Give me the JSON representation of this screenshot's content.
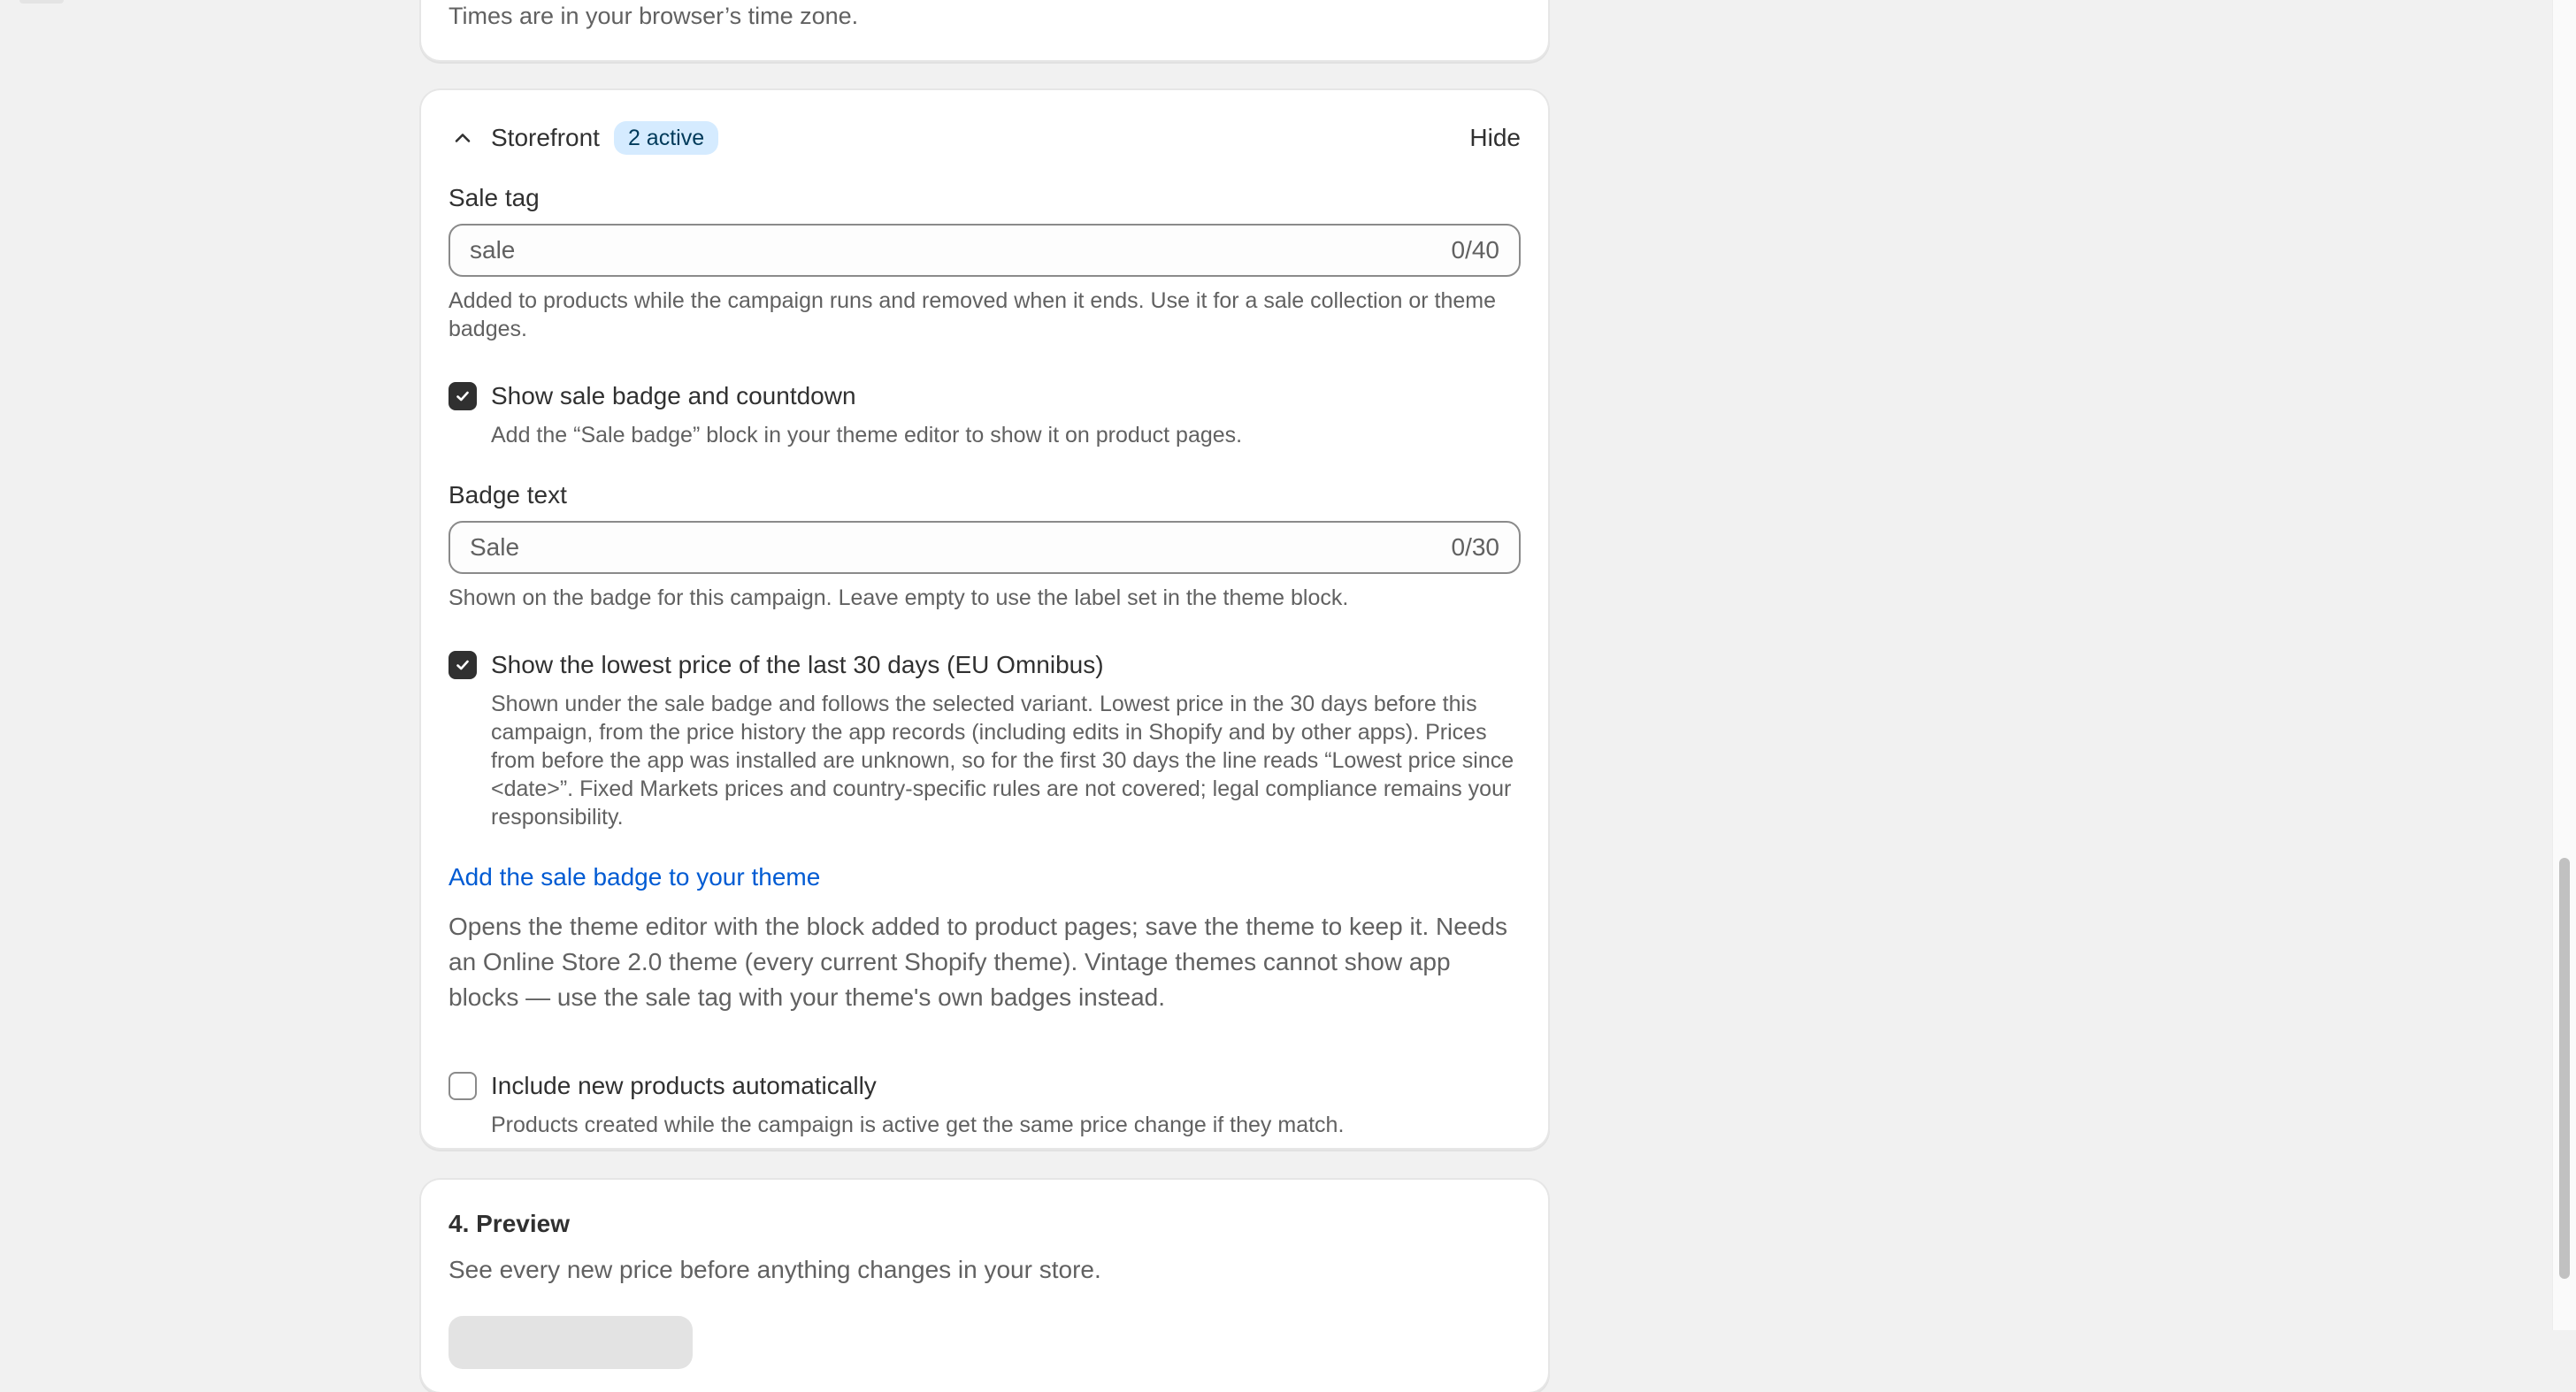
{
  "schedule": {
    "timezone_note": "Times are in your browser’s time zone."
  },
  "storefront": {
    "title": "Storefront",
    "badge": "2 active",
    "hide_label": "Hide",
    "sale_tag": {
      "label": "Sale tag",
      "placeholder": "sale",
      "value": "",
      "counter": "0/40",
      "help": "Added to products while the campaign runs and removed when it ends. Use it for a sale collection or theme badges."
    },
    "show_badge": {
      "checked": true,
      "label": "Show sale badge and countdown",
      "help": "Add the “Sale badge” block in your theme editor to show it on product pages."
    },
    "badge_text": {
      "label": "Badge text",
      "placeholder": "Sale",
      "value": "",
      "counter": "0/30",
      "help": "Shown on the badge for this campaign. Leave empty to use the label set in the theme block."
    },
    "lowest_price": {
      "checked": true,
      "label": "Show the lowest price of the last 30 days (EU Omnibus)",
      "help": "Shown under the sale badge and follows the selected variant. Lowest price in the 30 days before this campaign, from the price history the app records (including edits in Shopify and by other apps). Prices from before the app was installed are unknown, so for the first 30 days the line reads “Lowest price since <date>”. Fixed Markets prices and country-specific rules are not covered; legal compliance remains your responsibility."
    },
    "add_badge_link": "Add the sale badge to your theme",
    "theme_note": "Opens the theme editor with the block added to product pages; save the theme to keep it. Needs an Online Store 2.0 theme (every current Shopify theme). Vintage themes cannot show app blocks — use the sale tag with your theme's own badges instead.",
    "include_new": {
      "checked": false,
      "label": "Include new products automatically",
      "help": "Products created while the campaign is active get the same price change if they match."
    }
  },
  "preview": {
    "title": "4. Preview",
    "subtitle": "See every new price before anything changes in your store."
  },
  "icons": {
    "collapse": "chevron-up-icon",
    "check": "checkmark-icon"
  },
  "colors": {
    "link": "#005bd3",
    "badge_bg": "#d5ebff",
    "checkbox_checked": "#303030"
  }
}
